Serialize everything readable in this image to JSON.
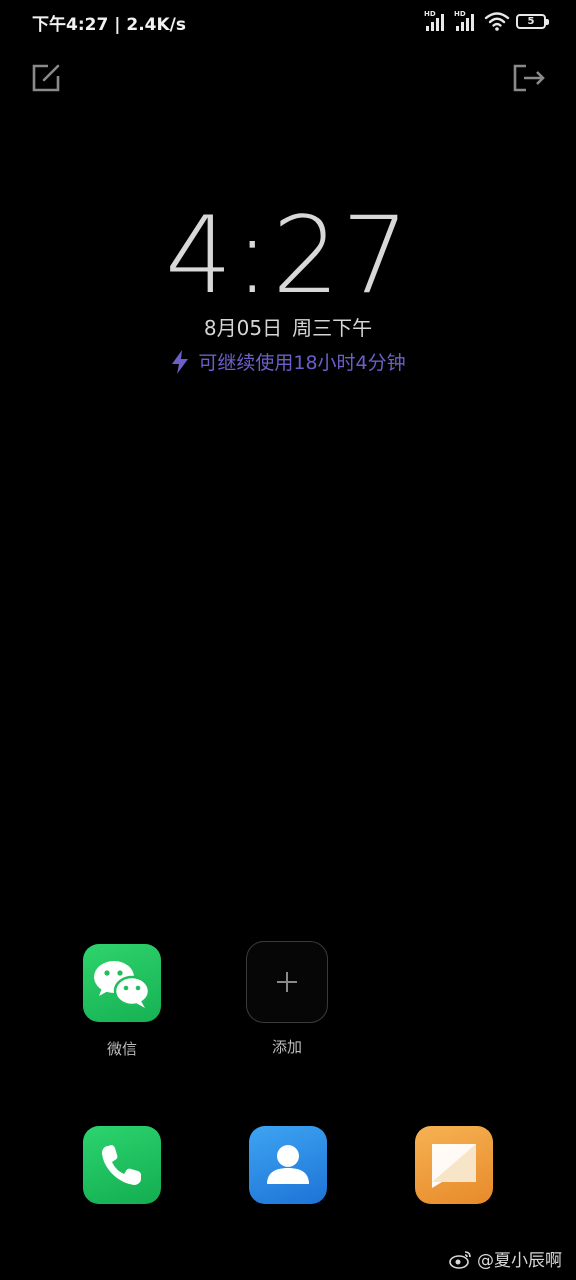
{
  "status_bar": {
    "time": "下午4:27",
    "separator": "|",
    "network_speed": "2.4K/s",
    "sim1_label": "HD",
    "sim2_label": "HD",
    "battery_level": "5"
  },
  "clock": {
    "time": "4:27",
    "date": "8月05日",
    "weekday": "周三下午"
  },
  "battery_hint": {
    "text": "可继续使用18小时4分钟",
    "color": "#6b5fc8"
  },
  "shortcuts": [
    {
      "label": "微信",
      "icon": "wechat-icon"
    },
    {
      "label": "添加",
      "icon": "plus-icon"
    }
  ],
  "dock": [
    {
      "icon": "phone-icon"
    },
    {
      "icon": "contacts-icon"
    },
    {
      "icon": "messages-icon"
    }
  ],
  "watermark": {
    "text": "@夏小辰啊",
    "icon": "weibo-icon"
  }
}
